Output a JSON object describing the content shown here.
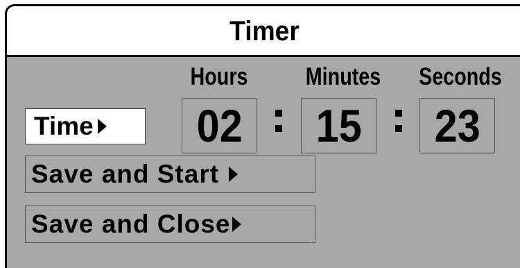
{
  "window": {
    "title": "Timer"
  },
  "columns": {
    "hours": "Hours",
    "minutes": "Minutes",
    "seconds": "Seconds"
  },
  "time_button": {
    "label": "Time"
  },
  "fields": {
    "hours": "02",
    "minutes": "15",
    "seconds": "23"
  },
  "separator": ":",
  "buttons": {
    "save_and_start": "Save and Start",
    "save_and_close": "Save and Close"
  },
  "icons": {
    "arrow": "right-triangle-arrow"
  },
  "colors": {
    "panel": "#a8a8a8",
    "title_bar": "#ffffff",
    "text": "#000000"
  }
}
